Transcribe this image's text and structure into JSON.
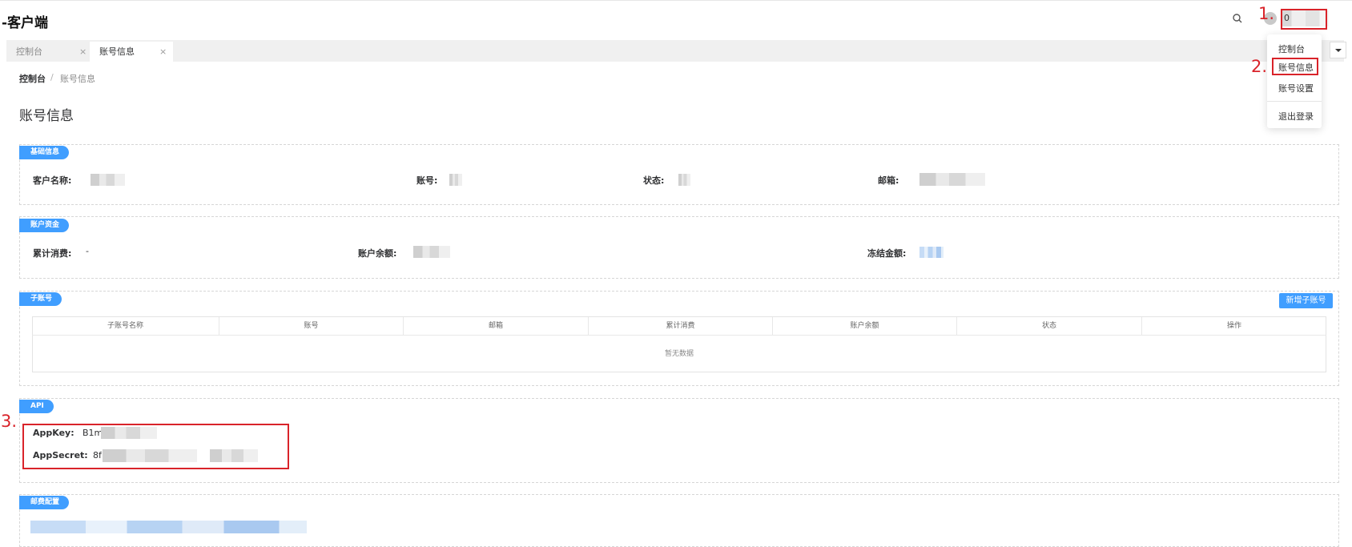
{
  "header": {
    "app_title": "-客户端",
    "user_name": "0",
    "search_icon": "search-icon",
    "avatar_icon": "avatar-icon"
  },
  "tabs": [
    {
      "label": "控制台",
      "close": "×"
    },
    {
      "label": "账号信息",
      "close": "×"
    }
  ],
  "user_menu": {
    "items": [
      "控制台",
      "账号信息",
      "账号设置",
      "退出登录"
    ]
  },
  "annotations": [
    "1.",
    "2.",
    "3."
  ],
  "breadcrumb": {
    "home": "控制台",
    "separator": "/",
    "current": "账号信息"
  },
  "page_title": "账号信息",
  "basic_info": {
    "section_label": "基础信息",
    "customer_name_label": "客户名称:",
    "account_label": "账号:",
    "status_label": "状态:",
    "email_label": "邮箱:"
  },
  "funds": {
    "section_label": "账户资金",
    "total_spend_label": "累计消费:",
    "total_spend_value": "-",
    "balance_label": "账户余额:",
    "frozen_label": "冻结金额:"
  },
  "sub_accounts": {
    "section_label": "子账号",
    "add_button": "新增子账号",
    "columns": [
      "子账号名称",
      "账号",
      "邮箱",
      "累计消费",
      "账户余额",
      "状态",
      "操作"
    ],
    "empty_text": "暂无数据"
  },
  "api": {
    "section_label": "API",
    "app_key_label": "AppKey:",
    "app_key_value": "B1m",
    "app_secret_label": "AppSecret:",
    "app_secret_value": "8f"
  },
  "mail_config": {
    "section_label": "邮费配置"
  },
  "colors": {
    "primary": "#409eff",
    "annotation": "#d9232a"
  }
}
